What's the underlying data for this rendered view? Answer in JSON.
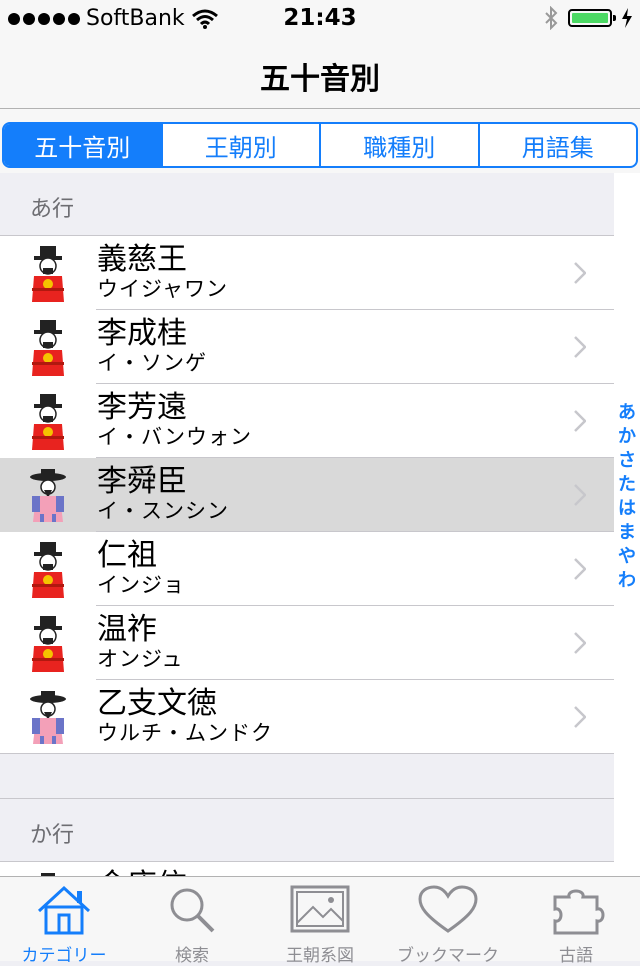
{
  "status_bar": {
    "carrier": "SoftBank",
    "time": "21:43",
    "battery_level": 1.0
  },
  "nav": {
    "title": "五十音別"
  },
  "segmented": {
    "items": [
      "五十音別",
      "王朝別",
      "職種別",
      "用語集"
    ],
    "selected_index": 0
  },
  "sections": [
    {
      "header": "あ行",
      "rows": [
        {
          "title": "義慈王",
          "subtitle": "ウイジャワン",
          "icon": "king-icon"
        },
        {
          "title": "李成桂",
          "subtitle": "イ・ソンゲ",
          "icon": "king-icon"
        },
        {
          "title": "李芳遠",
          "subtitle": "イ・バンウォン",
          "icon": "king-icon"
        },
        {
          "title": "李舜臣",
          "subtitle": "イ・スンシン",
          "icon": "official-icon",
          "selected": true
        },
        {
          "title": "仁祖",
          "subtitle": "インジョ",
          "icon": "king-icon"
        },
        {
          "title": "温祚",
          "subtitle": "オンジュ",
          "icon": "king-icon"
        },
        {
          "title": "乙支文徳",
          "subtitle": "ウルチ・ムンドク",
          "icon": "official-icon"
        }
      ]
    },
    {
      "header": "か行",
      "rows": [
        {
          "title": "金庾信",
          "subtitle": "",
          "icon": "official-icon"
        }
      ]
    }
  ],
  "index": [
    "あ",
    "か",
    "さ",
    "た",
    "は",
    "ま",
    "や",
    "わ"
  ],
  "tab_bar": {
    "items": [
      {
        "label": "カテゴリー",
        "icon": "home-icon",
        "active": true
      },
      {
        "label": "検索",
        "icon": "search-icon"
      },
      {
        "label": "王朝系図",
        "icon": "image-icon"
      },
      {
        "label": "ブックマーク",
        "icon": "heart-icon"
      },
      {
        "label": "古語",
        "icon": "puzzle-icon"
      }
    ]
  },
  "colors": {
    "accent": "#147efb",
    "battery": "#4cd964",
    "row_selected": "#d9d9d9"
  }
}
